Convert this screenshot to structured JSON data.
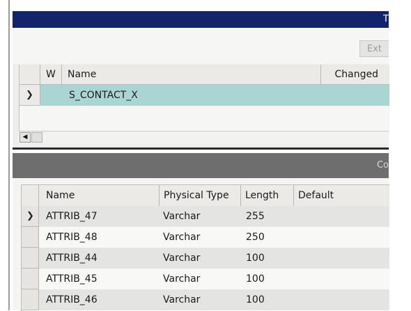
{
  "top_window": {
    "title_fragment": "T",
    "ext_button": "Ext",
    "grid": {
      "columns": [
        "W",
        "Name",
        "Changed"
      ],
      "rows": [
        {
          "name": "S_CONTACT_X",
          "selected": true
        }
      ]
    }
  },
  "bottom_window": {
    "title_fragment": "Co",
    "grid": {
      "columns": [
        "Name",
        "Physical Type",
        "Length",
        "Default"
      ],
      "rows": [
        {
          "name": "ATTRIB_47",
          "type": "Varchar",
          "length": "255",
          "default": ""
        },
        {
          "name": "ATTRIB_48",
          "type": "Varchar",
          "length": "250",
          "default": ""
        },
        {
          "name": "ATTRIB_44",
          "type": "Varchar",
          "length": "100",
          "default": ""
        },
        {
          "name": "ATTRIB_45",
          "type": "Varchar",
          "length": "100",
          "default": ""
        },
        {
          "name": "ATTRIB_46",
          "type": "Varchar",
          "length": "100",
          "default": ""
        }
      ]
    }
  },
  "colors": {
    "title_bar_active": "#14246b",
    "title_bar_inactive": "#6e6e6e",
    "selected_row": "#a9d6d3"
  },
  "icons": {
    "row_pointer": "chevron-right-icon",
    "scroll_left": "scroll-left-arrow-icon"
  }
}
